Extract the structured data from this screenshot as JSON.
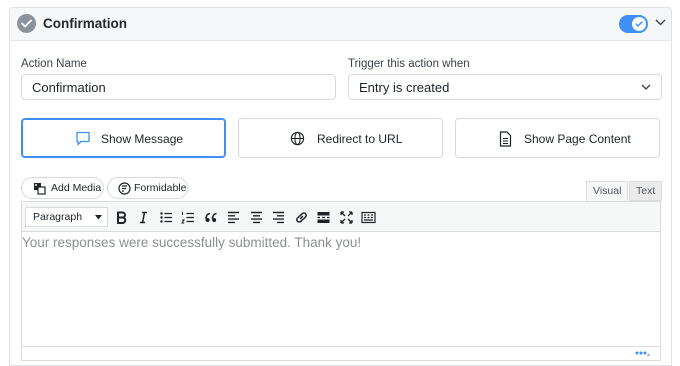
{
  "header": {
    "title": "Confirmation",
    "enabled": true,
    "accent_color": "#3f8ff6"
  },
  "form": {
    "action_name_label": "Action Name",
    "action_name_value": "Confirmation",
    "trigger_label": "Trigger this action when",
    "trigger_value": "Entry is created"
  },
  "actions": [
    {
      "label": "Show Message",
      "icon": "chat-bubble-icon",
      "selected": true
    },
    {
      "label": "Redirect to URL",
      "icon": "globe-icon",
      "selected": false
    },
    {
      "label": "Show Page Content",
      "icon": "document-icon",
      "selected": false
    }
  ],
  "media_buttons": {
    "add_media": "Add Media",
    "formidable": "Formidable"
  },
  "editor_tabs": {
    "visual": "Visual",
    "text": "Text",
    "active": "Visual"
  },
  "toolbar": {
    "format_value": "Paragraph",
    "buttons": [
      "bold-icon",
      "italic-icon",
      "bullet-list-icon",
      "numbered-list-icon",
      "blockquote-icon",
      "align-left-icon",
      "align-center-icon",
      "align-right-icon",
      "link-icon",
      "read-more-icon",
      "fullscreen-icon",
      "toolbar-toggle-icon"
    ]
  },
  "editor": {
    "content": "Your responses were successfully submitted. Thank you!"
  }
}
